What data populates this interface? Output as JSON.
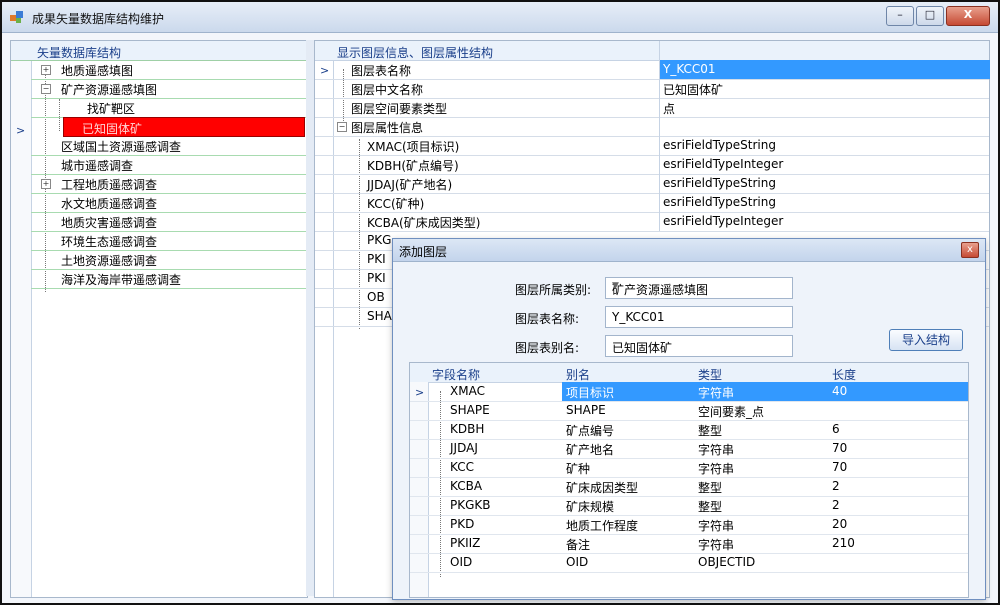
{
  "window": {
    "title": "成果矢量数据库结构维护",
    "buttons": {
      "minimize": "–",
      "maximize": "□",
      "close": "X"
    }
  },
  "left_tree": {
    "header": "矢量数据库结构",
    "items": [
      {
        "label": "地质遥感填图",
        "expander": "+",
        "level": 0
      },
      {
        "label": "矿产资源遥感填图",
        "expander": "−",
        "level": 0
      },
      {
        "label": "找矿靶区",
        "level": 1
      },
      {
        "label": "已知固体矿",
        "level": 1,
        "selected": true
      },
      {
        "label": "区域国土资源遥感调查",
        "level": 0
      },
      {
        "label": "城市遥感调查",
        "level": 0
      },
      {
        "label": "工程地质遥感调查",
        "expander": "+",
        "level": 0
      },
      {
        "label": "水文地质遥感调查",
        "level": 0
      },
      {
        "label": "地质灾害遥感调查",
        "level": 0
      },
      {
        "label": "环境生态遥感调查",
        "level": 0
      },
      {
        "label": "土地资源遥感调查",
        "level": 0
      },
      {
        "label": "海洋及海岸带遥感调查",
        "level": 0
      }
    ],
    "row_indicator": ">"
  },
  "right_panel": {
    "header": "显示图层信息、图层属性结构",
    "row_indicator": ">",
    "rows": [
      {
        "name": "图层表名称",
        "value": "Y_KCC01",
        "selected": true
      },
      {
        "name": "图层中文名称",
        "value": "已知固体矿"
      },
      {
        "name": "图层空间要素类型",
        "value": "点"
      },
      {
        "name": "图层属性信息",
        "value": ""
      },
      {
        "name": "XMAC(项目标识)",
        "value": "esriFieldTypeString"
      },
      {
        "name": "KDBH(矿点编号)",
        "value": "esriFieldTypeInteger"
      },
      {
        "name": "JJDAJ(矿产地名)",
        "value": "esriFieldTypeString"
      },
      {
        "name": "KCC(矿种)",
        "value": "esriFieldTypeString"
      },
      {
        "name": "KCBA(矿床成因类型)",
        "value": "esriFieldTypeInteger"
      },
      {
        "name": "PKG",
        "value": ""
      },
      {
        "name": "PKI",
        "value": ""
      },
      {
        "name": "PKI",
        "value": ""
      },
      {
        "name": "OB",
        "value": ""
      },
      {
        "name": "SHA",
        "value": ""
      }
    ]
  },
  "dialog": {
    "title": "添加图层",
    "close": "x",
    "category_label": "图层所属类别:",
    "category_value": "矿产资源遥感填图",
    "table_name_label": "图层表名称:",
    "table_name_value": "Y_KCC01",
    "alias_label": "图层表别名:",
    "alias_value": "已知固体矿",
    "import_button": "导入结构",
    "grid": {
      "columns": [
        "字段名称",
        "别名",
        "类型",
        "长度"
      ],
      "row_indicator": ">",
      "rows": [
        {
          "field": "XMAC",
          "alias": "项目标识",
          "type": "字符串",
          "length": "40",
          "selected": true
        },
        {
          "field": "SHAPE",
          "alias": "SHAPE",
          "type": "空间要素_点",
          "length": ""
        },
        {
          "field": "KDBH",
          "alias": "矿点编号",
          "type": "整型",
          "length": "6"
        },
        {
          "field": "JJDAJ",
          "alias": "矿产地名",
          "type": "字符串",
          "length": "70"
        },
        {
          "field": "KCC",
          "alias": "矿种",
          "type": "字符串",
          "length": "70"
        },
        {
          "field": "KCBA",
          "alias": "矿床成因类型",
          "type": "整型",
          "length": "2"
        },
        {
          "field": "PKGKB",
          "alias": "矿床规模",
          "type": "整型",
          "length": "2"
        },
        {
          "field": "PKD",
          "alias": "地质工作程度",
          "type": "字符串",
          "length": "20"
        },
        {
          "field": "PKIIZ",
          "alias": "备注",
          "type": "字符串",
          "length": "210"
        },
        {
          "field": "OID",
          "alias": "OID",
          "type": "OBJECTID",
          "length": ""
        }
      ]
    }
  },
  "colors": {
    "selected_tree": "#ff0000",
    "selected_cell": "#3399ff",
    "header_text": "#1a3f8a"
  },
  "icons": [
    "app-icon",
    "minimize-icon",
    "maximize-icon",
    "close-icon",
    "expand-icon",
    "collapse-icon",
    "dropdown-arrow-icon",
    "row-pointer-icon"
  ]
}
